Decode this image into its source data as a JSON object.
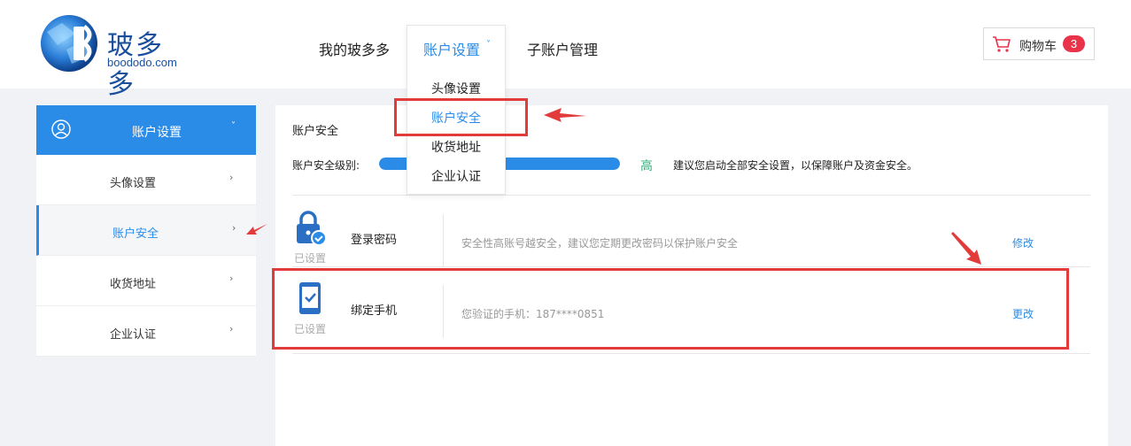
{
  "header": {
    "logo_name": "玻多多",
    "logo_domain": "boododo.com",
    "nav": {
      "mine": "我的玻多多",
      "account": "账户设置",
      "sub_accounts": "子账户管理"
    },
    "dropdown": {
      "avatar": "头像设置",
      "security": "账户安全",
      "address": "收货地址",
      "enterprise": "企业认证"
    },
    "cart": {
      "label": "购物车",
      "count": "3"
    }
  },
  "sidebar": {
    "head": "账户设置",
    "items": [
      {
        "label": "头像设置"
      },
      {
        "label": "账户安全"
      },
      {
        "label": "收货地址"
      },
      {
        "label": "企业认证"
      }
    ]
  },
  "main": {
    "title": "账户安全",
    "level_label": "账户安全级别:",
    "level_fraction": 1.0,
    "level_value": "高",
    "level_tip": "建议您启动全部安全设置，以保障账户及资金安全。",
    "rows": [
      {
        "name": "登录密码",
        "status": "已设置",
        "desc": "安全性高账号越安全，建议您定期更改密码以保护账户安全",
        "action": "修改"
      },
      {
        "name": "绑定手机",
        "status": "已设置",
        "desc": "您验证的手机：187****0851",
        "action": "更改"
      }
    ]
  },
  "colors": {
    "accent": "#2b8ce8",
    "level_ok": "#31b27a",
    "badge": "#e8334a",
    "annotation": "#e23b3b"
  }
}
